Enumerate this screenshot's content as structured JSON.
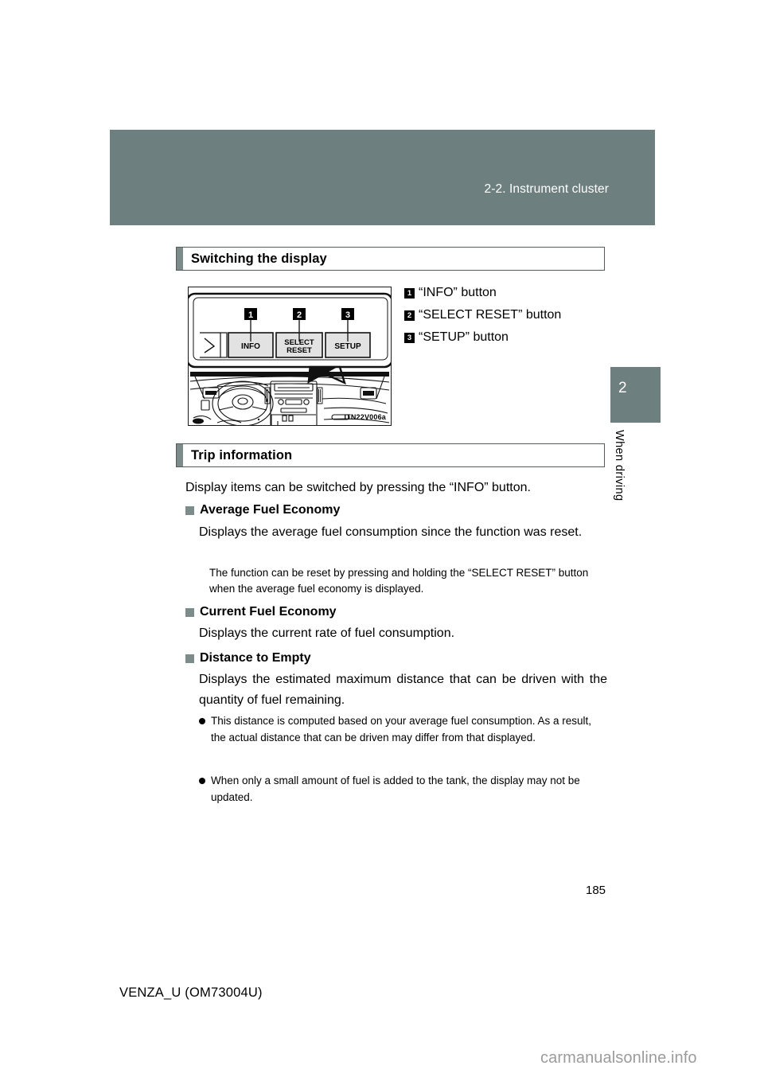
{
  "header": {
    "section_ref": "2-2. Instrument cluster"
  },
  "chapter_tab": {
    "number": "2",
    "label": "When driving"
  },
  "sections": [
    {
      "title": "Switching the display"
    },
    {
      "title": "Trip information"
    }
  ],
  "figure": {
    "code": "ITN22V006a",
    "buttons": [
      {
        "number": "1",
        "label_line1": "INFO",
        "label_line2": ""
      },
      {
        "number": "2",
        "label_line1": "SELECT",
        "label_line2": "RESET"
      },
      {
        "number": "3",
        "label_line1": "SETUP",
        "label_line2": ""
      }
    ]
  },
  "legend": [
    {
      "number": "1",
      "text": "“INFO” button"
    },
    {
      "number": "2",
      "text": "“SELECT RESET” button"
    },
    {
      "number": "3",
      "text": "“SETUP” button"
    }
  ],
  "trip_information": {
    "intro": "Display items can be switched by pressing the “INFO” button.",
    "items": [
      {
        "heading": "Average Fuel Economy",
        "body": "Displays the average fuel consumption since the function was reset.",
        "note": "The function can be reset by pressing and holding the “SELECT RESET” button when the average fuel economy is displayed."
      },
      {
        "heading": "Current Fuel Economy",
        "body": "Displays the current rate of fuel consumption."
      },
      {
        "heading": "Distance to Empty",
        "body": "Displays the estimated maximum distance that can be driven with the quantity of fuel remaining.",
        "bullets": [
          "This distance is computed based on your average fuel consumption. As a result, the actual distance that can be driven may differ from that displayed.",
          "When only a small amount of fuel is added to the tank, the display may not be updated."
        ]
      }
    ]
  },
  "footer": {
    "page_number": "185",
    "document_code": "VENZA_U (OM73004U)",
    "watermark": "carmanualsonline.info"
  },
  "colors": {
    "header_band": "#6d7f7e",
    "accent": "#7b8c8a",
    "text": "#000000",
    "watermark": "#9b9b9b"
  }
}
